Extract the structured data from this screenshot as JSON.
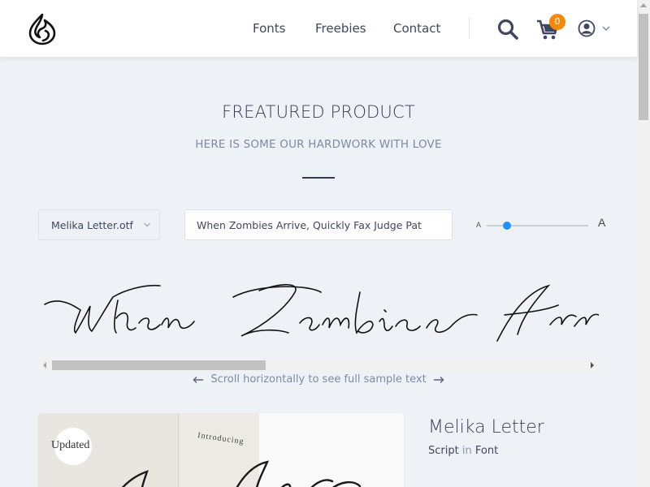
{
  "header": {
    "logo": "flame-drop-logo",
    "nav": [
      "Fonts",
      "Freebies",
      "Contact"
    ],
    "cart_count": "0",
    "icons": [
      "search-icon",
      "cart-icon",
      "user-icon",
      "chevron-down-icon"
    ]
  },
  "section": {
    "title": "FREATURED PRODUCT",
    "subtitle": "HERE IS SOME OUR HARDWORK WITH LOVE"
  },
  "controls": {
    "font_select": "Melika Letter.otf",
    "sample_text": "When Zombies Arrive, Quickly Fax Judge Pat",
    "size_small_label": "A",
    "size_large_label": "A"
  },
  "preview": {
    "text": "When Zombies Arr",
    "scroll_hint": "Scroll horizontally to see full sample text"
  },
  "product": {
    "badge": "Updated",
    "introducing": "Introducing",
    "name": "Melika Letter",
    "category": "Script",
    "in_word": "in",
    "type": "Font"
  },
  "colors": {
    "accent": "#f58a07",
    "slider": "#1f8fff",
    "background": "#eef2f7"
  }
}
